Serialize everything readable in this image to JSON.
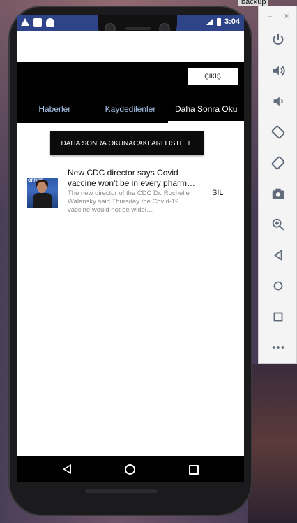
{
  "window": {
    "title": "backup"
  },
  "status_bar": {
    "time": "3:04"
  },
  "app_bar": {
    "exit_label": "ÇIKIŞ",
    "tabs": [
      {
        "label": "Haberler",
        "active": false
      },
      {
        "label": "Kaydedilenler",
        "active": false
      },
      {
        "label": "Daha Sonra Oku",
        "active": true
      }
    ]
  },
  "main": {
    "list_button_label": "DAHA SONRA OKUNACAKLARI LISTELE",
    "items": [
      {
        "title": "New CDC director says Covid vaccine won't be in every pharm…",
        "description": "The new director of the CDC Dr. Rochelle Walensky said Thursday the Covid-19 vaccine would not be widel…",
        "delete_label": "SIL",
        "thumbnail_text": "OFFICE"
      }
    ]
  },
  "emulator_toolbar": {
    "minimize": "–",
    "close": "×",
    "buttons": [
      "power-icon",
      "volume-up-icon",
      "volume-down-icon",
      "rotate-left-icon",
      "rotate-right-icon",
      "camera-icon",
      "zoom-icon",
      "back-icon",
      "home-icon",
      "overview-icon",
      "more-icon"
    ]
  }
}
